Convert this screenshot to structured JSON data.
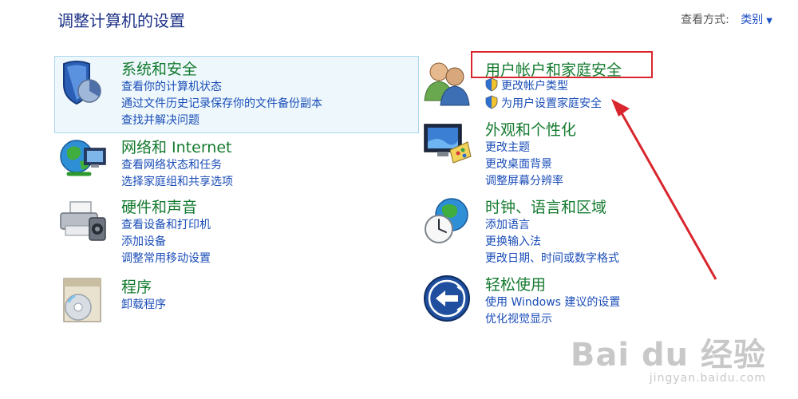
{
  "page": {
    "title": "调整计算机的设置",
    "view_by_label": "查看方式:",
    "view_by_value": "类别"
  },
  "categories": [
    {
      "heading": "系统和安全",
      "icon": "shield-security-icon",
      "links": [
        "查看你的计算机状态",
        "通过文件历史记录保存你的文件备份副本",
        "查找并解决问题"
      ]
    },
    {
      "heading": "网络和 Internet",
      "icon": "network-globe-icon",
      "links": [
        "查看网络状态和任务",
        "选择家庭组和共享选项"
      ]
    },
    {
      "heading": "硬件和声音",
      "icon": "printer-speaker-icon",
      "links": [
        "查看设备和打印机",
        "添加设备",
        "调整常用移动设置"
      ]
    },
    {
      "heading": "程序",
      "icon": "programs-disc-icon",
      "links": [
        "卸载程序"
      ]
    },
    {
      "heading": "用户帐户和家庭安全",
      "icon": "users-icon",
      "links": [
        "更改帐户类型",
        "为用户设置家庭安全"
      ]
    },
    {
      "heading": "外观和个性化",
      "icon": "monitor-palette-icon",
      "links": [
        "更改主题",
        "更改桌面背景",
        "调整屏幕分辨率"
      ]
    },
    {
      "heading": "时钟、语言和区域",
      "icon": "clock-globe-icon",
      "links": [
        "添加语言",
        "更换输入法",
        "更改日期、时间或数字格式"
      ]
    },
    {
      "heading": "轻松使用",
      "icon": "ease-of-access-icon",
      "links": [
        "使用 Windows 建议的设置",
        "优化视觉显示"
      ]
    }
  ],
  "watermark": {
    "brand": "Bai du 经验",
    "site": "jingyan.baidu.com"
  },
  "colors": {
    "heading": "#137a2e",
    "link": "#1a4db8",
    "title": "#1e3287",
    "annotation": "#d9262e"
  }
}
